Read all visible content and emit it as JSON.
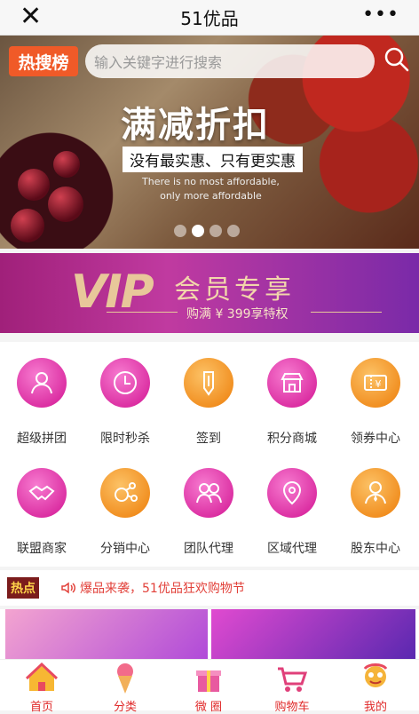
{
  "titlebar": {
    "title": "51优品",
    "close": "✕",
    "more": "•••"
  },
  "header": {
    "hot_logo": "热搜榜",
    "search_placeholder": "输入关键字进行搜索"
  },
  "banner": {
    "headline": "满减折扣",
    "sub": "没有最实惠、只有更实惠",
    "english_1": "There is no most affordable,",
    "english_2": "only more affordable",
    "slide_count": 4,
    "active_slide": 2
  },
  "vip": {
    "letters": "VIP",
    "title": "会员专享",
    "sub": "购满 ¥ 399享特权"
  },
  "grid": [
    {
      "label": "超级拼团",
      "icon": "group-icon",
      "color": "pink"
    },
    {
      "label": "限时秒杀",
      "icon": "clock-icon",
      "color": "pink"
    },
    {
      "label": "签到",
      "icon": "pencil-icon",
      "color": "orange"
    },
    {
      "label": "积分商城",
      "icon": "store-icon",
      "color": "pink"
    },
    {
      "label": "领券中心",
      "icon": "coupon-icon",
      "color": "orange"
    },
    {
      "label": "联盟商家",
      "icon": "handshake-icon",
      "color": "pink"
    },
    {
      "label": "分销中心",
      "icon": "share-icon",
      "color": "orange"
    },
    {
      "label": "团队代理",
      "icon": "team-icon",
      "color": "pink"
    },
    {
      "label": "区域代理",
      "icon": "map-pin-icon",
      "color": "pink"
    },
    {
      "label": "股东中心",
      "icon": "shareholder-icon",
      "color": "orange"
    }
  ],
  "news": {
    "tag": "热点",
    "text": "爆品来袭，51优品狂欢购物节"
  },
  "tabbar": [
    {
      "label": "首页",
      "icon": "home-icon"
    },
    {
      "label": "分类",
      "icon": "ice-cream-icon"
    },
    {
      "label": "微 圈",
      "icon": "gift-box-icon"
    },
    {
      "label": "购物车",
      "icon": "cart-icon"
    },
    {
      "label": "我的",
      "icon": "profile-icon"
    }
  ],
  "colors": {
    "accent": "#e02a2a",
    "pink": "#d9289e",
    "orange": "#f08a1a"
  }
}
